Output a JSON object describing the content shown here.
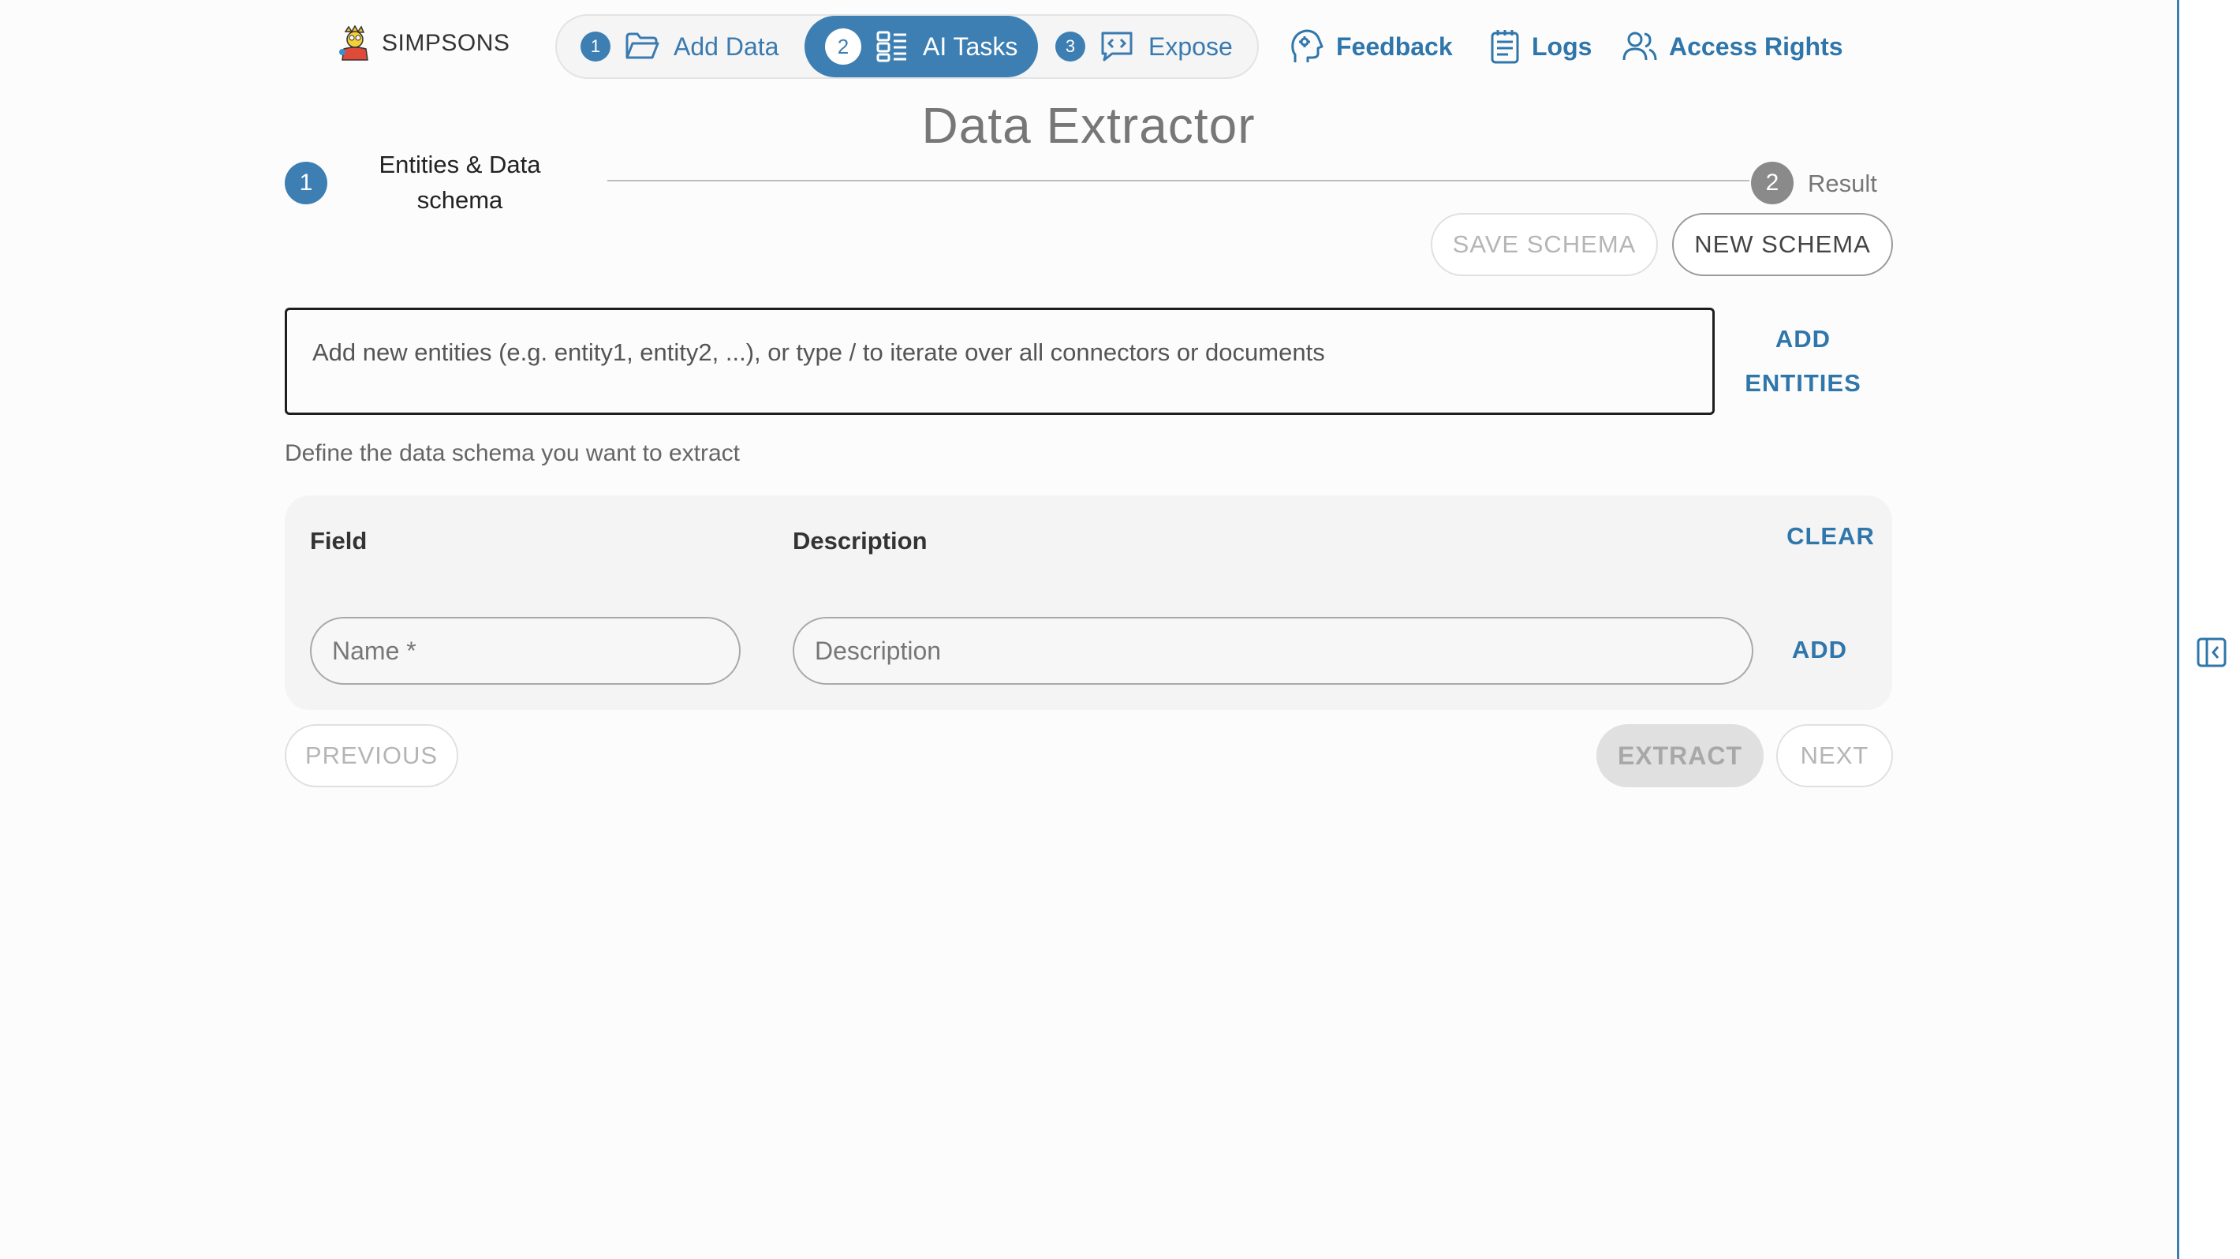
{
  "brand": {
    "name": "SIMPSONS"
  },
  "stepper": {
    "steps": [
      {
        "number": "1",
        "label": "Add Data",
        "icon": "folder-open-icon"
      },
      {
        "number": "2",
        "label": "AI Tasks",
        "icon": "grid-list-icon"
      },
      {
        "number": "3",
        "label": "Expose",
        "icon": "code-chat-icon"
      }
    ],
    "active_step": "2"
  },
  "nav": {
    "feedback": "Feedback",
    "logs": "Logs",
    "access_rights": "Access Rights"
  },
  "page": {
    "title": "Data Extractor"
  },
  "stages": [
    {
      "number": "1",
      "label_line1": "Entities & Data",
      "label_line2": "schema"
    },
    {
      "number": "2",
      "label": "Result"
    }
  ],
  "schema_actions": {
    "save": "SAVE SCHEMA",
    "new": "NEW SCHEMA"
  },
  "entities": {
    "placeholder": "Add new entities (e.g. entity1, entity2, ...), or type / to iterate over all connectors or documents",
    "add_line1": "ADD",
    "add_line2": "ENTITIES"
  },
  "helper_text": "Define the data schema you want to extract",
  "schema_table": {
    "field_header": "Field",
    "description_header": "Description",
    "clear": "CLEAR",
    "name_placeholder": "Name *",
    "description_placeholder": "Description",
    "add": "ADD"
  },
  "footer": {
    "previous": "PREVIOUS",
    "extract": "EXTRACT",
    "next": "NEXT"
  },
  "colors": {
    "accent": "#3d7fb3",
    "link": "#2f76ab",
    "stage_inactive": "#8a8a8a"
  }
}
